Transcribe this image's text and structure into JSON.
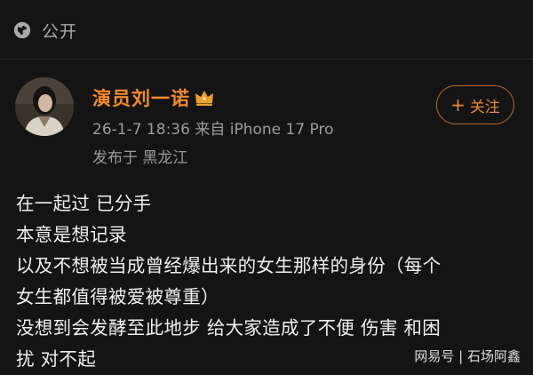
{
  "header": {
    "visibility_label": "公开",
    "visibility_icon": "globe-icon"
  },
  "author": {
    "name": "演员刘一诺",
    "badge_icon": "crown-icon",
    "badge_color": "#e8a32a",
    "name_color": "#f28a2e",
    "meta": "26-1-7 18:36  来自 iPhone 17 Pro",
    "location": "发布于 黑龙江",
    "follow_label": "关注",
    "follow_icon": "plus-icon"
  },
  "post": {
    "lines": [
      "在一起过 已分手",
      "本意是想记录",
      "以及不想被当成曾经爆出来的女生那样的身份（每个",
      "女生都值得被爱被尊重）",
      "没想到会发酵至此地步 给大家造成了不便 伤害 和困",
      "扰 对不起"
    ]
  },
  "watermark": "网易号 | 石场阿鑫"
}
